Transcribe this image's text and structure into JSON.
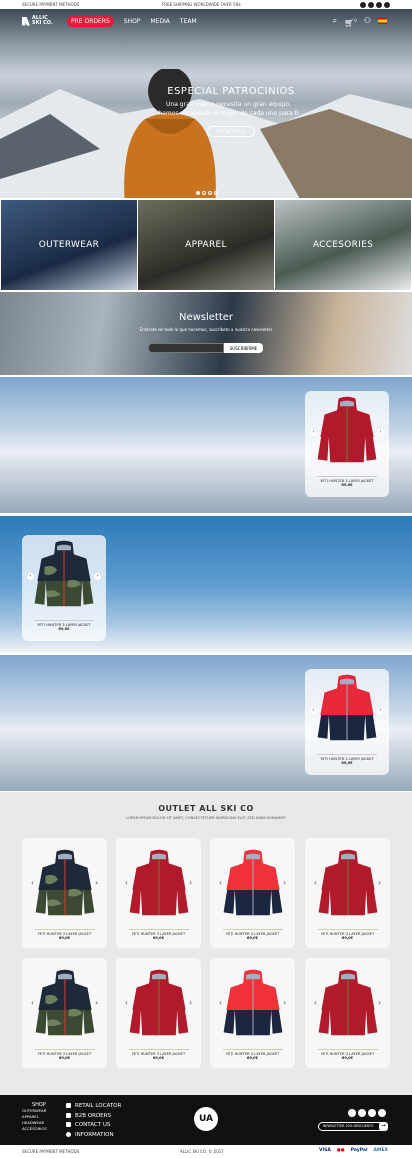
{
  "topbar": {
    "secure": "SECURE PAYMENT METHODS",
    "shipping": "FREE SHIPPING WORLDWIDE OVER 59$",
    "social": [
      "facebook-icon",
      "instagram-icon",
      "vimeo-icon",
      "mail-icon"
    ]
  },
  "nav": {
    "logo_line1": "ALLIC",
    "logo_line2": "SKI CO.",
    "items": [
      "PRE ORDERS",
      "SHOP",
      "MEDIA",
      "TEAM"
    ],
    "accent": "#e51b3a",
    "icons": [
      "search-icon",
      "cart-icon",
      "user-icon",
      "flag-es-icon"
    ],
    "cart_count": "0"
  },
  "hero": {
    "title": "ESPECIAL PATROCINIOS",
    "line1": "Una gran marca necesita un gran equipo,",
    "line2": "hemos recopilado lo mejor de cada uno para ti",
    "button": "VER DETALLES",
    "slides": 4,
    "active_slide": 1
  },
  "categories": [
    "OUTERWEAR",
    "APPAREL",
    "ACCESORIES"
  ],
  "newsletter": {
    "title": "Newsletter",
    "text": "Entérate de todo lo que hacemos, suscríbete a nuestra newsletter",
    "placeholder": "",
    "button": "SUSCRIBIRME"
  },
  "banners": [
    {
      "product": {
        "name": "YETI HUNTER 3 LAYER JACKET",
        "price": "69,0€",
        "style": "red"
      }
    },
    {
      "product": {
        "name": "YETI HUNTER 3 LAYER JACKET",
        "price": "69,0€",
        "style": "camo"
      }
    },
    {
      "product": {
        "name": "YETI HUNTER 3 LAYER JACKET",
        "price": "69,0€",
        "style": "navyred"
      }
    }
  ],
  "outlet": {
    "title": "OUTLET ALL SKI CO",
    "subtitle": "LOREM IPSUM DOLOR SIT AMET, CONSECTETUER ADIPISCING ELIT, SED DIAM NONUMMY",
    "products": [
      {
        "name": "YETI HUNTER 3 LAYER JACKET",
        "price": "69,0€",
        "style": "camo"
      },
      {
        "name": "YETI HUNTER 3 LAYER JACKET",
        "price": "69,0€",
        "style": "red"
      },
      {
        "name": "YETI HUNTER 3 LAYER JACKET",
        "price": "69,0€",
        "style": "rednavy"
      },
      {
        "name": "YETI HUNTER 3 LAYER JACKET",
        "price": "69,0€",
        "style": "red"
      },
      {
        "name": "YETI HUNTER 3 LAYER JACKET",
        "price": "69,0€",
        "style": "camo"
      },
      {
        "name": "YETI HUNTER 3 LAYER JACKET",
        "price": "69,0€",
        "style": "red"
      },
      {
        "name": "YETI HUNTER 3 LAYER JACKET",
        "price": "69,0€",
        "style": "rednavy"
      },
      {
        "name": "YETI HUNTER 3 LAYER JACKET",
        "price": "69,0€",
        "style": "red"
      }
    ]
  },
  "footer": {
    "shop": "SHOP",
    "shop_items": [
      "OUTERWEAR",
      "APPAREL",
      "HEADWEAR",
      "ACCESORIOS"
    ],
    "links": [
      "RETAIL LOCATOR",
      "B2B ORDERS",
      "CONTACT US",
      "INFORMATION"
    ],
    "logo": "UA",
    "newsletter": "NEWSLETTER 10% DESCUENTO",
    "secure": "SECURE PAYMENT METHODS",
    "copyright": "ALLIC SKI CO. © 2017",
    "payments": [
      "VISA",
      "MasterCard",
      "PayPal",
      "AMEX"
    ]
  }
}
